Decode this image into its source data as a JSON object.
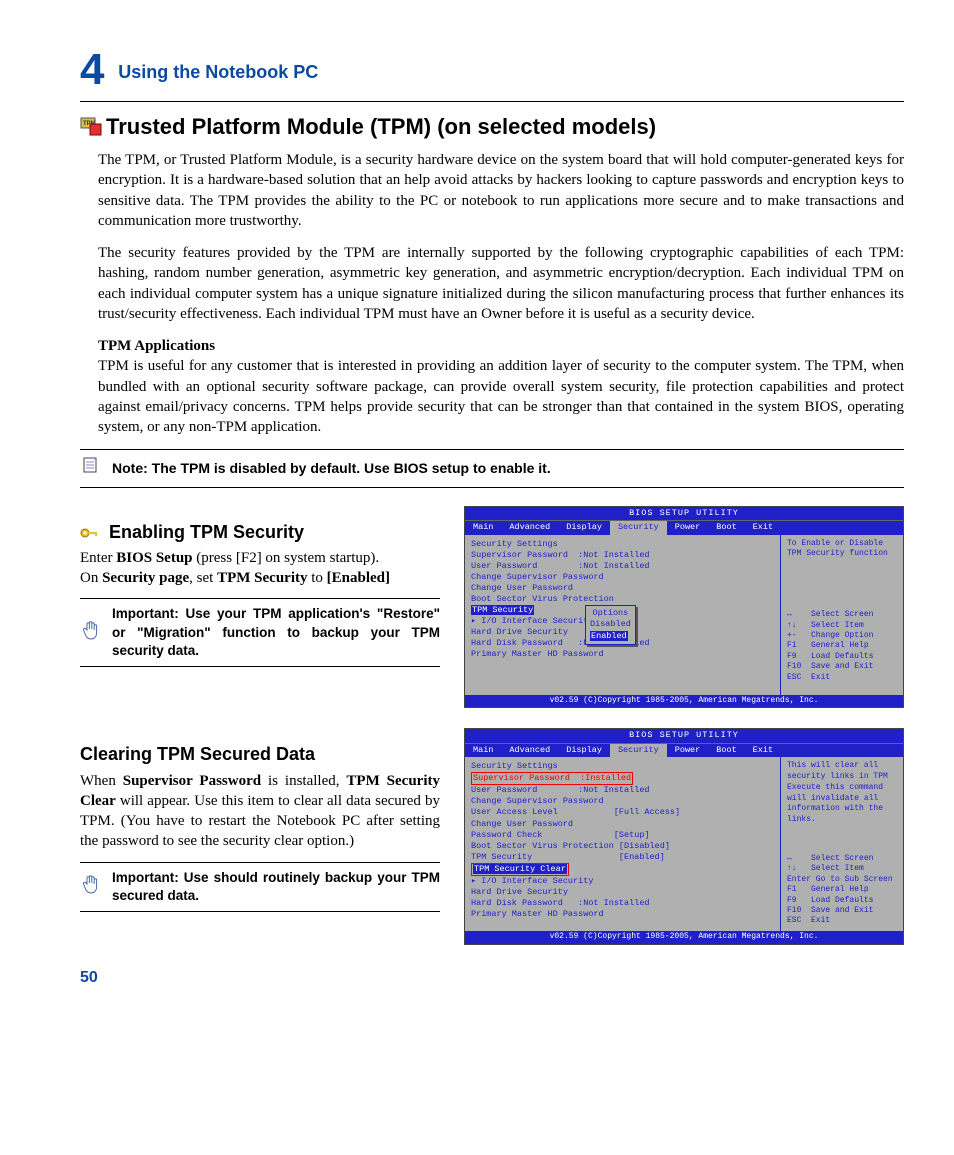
{
  "chapter": {
    "num": "4",
    "title": "Using the Notebook PC"
  },
  "h1": "Trusted Platform Module (TPM) (on selected models)",
  "p1": "The TPM, or Trusted Platform Module, is a security hardware device on the system board that will hold computer-generated keys for encryption. It is a hardware-based solution that an help avoid attacks by hackers looking to capture passwords and encryption keys to sensitive data. The TPM provides the ability to the PC or notebook to run applications more secure and to make transactions and communication more trustworthy.",
  "p2": "The security features provided by the TPM are internally supported by the following cryptographic capabilities of each TPM: hashing, random number generation, asymmetric key generation, and asymmetric encryption/decryption. Each individual TPM on each individual computer system has a unique signature initialized during the silicon manufacturing process that further enhances its trust/security effectiveness. Each individual TPM must have an Owner before it is useful as a security device.",
  "apps_h": "TPM Applications",
  "apps_p": "TPM is useful for any customer that is interested in providing an addition layer of security to the computer system. The TPM, when bundled with an optional security software package, can provide overall system security, file protection capabilities and protect against email/privacy concerns. TPM helps provide security that can be stronger than that contained in the system BIOS, operating system, or any non-TPM application.",
  "note1": "Note: The TPM is disabled by default. Use BIOS setup to enable it.",
  "enable_h": "Enabling TPM Security",
  "enable_p1a": "Enter ",
  "enable_p1b": "BIOS Setup",
  "enable_p1c": " (press [F2] on system startup).",
  "enable_p2a": "On ",
  "enable_p2b": "Security page",
  "enable_p2c": ", set ",
  "enable_p2d": "TPM Security",
  "enable_p2e": " to ",
  "enable_p2f": "[Enabled]",
  "important1": "Important: Use your TPM application's \"Restore\" or \"Migration\" function to backup your TPM security data.",
  "clear_h": "Clearing TPM Secured Data",
  "clear_pa": "When ",
  "clear_pb": "Supervisor Password",
  "clear_pc": " is installed, ",
  "clear_pd": "TPM Security Clear",
  "clear_pe": " will appear. Use this item to clear all data secured by TPM. (You have to restart the Notebook PC after setting the password to see the security clear option.)",
  "important2": "Important: Use should routinely backup your TPM secured data.",
  "page": "50",
  "bios": {
    "title": "BIOS SETUP UTILITY",
    "menu": [
      "Main",
      "Advanced",
      "Display",
      "Security",
      "Power",
      "Boot",
      "Exit"
    ],
    "footer": "v02.59 (C)Copyright 1985-2005, American Megatrends, Inc.",
    "box1": {
      "hint": "To Enable or Disable\nTPM Security function",
      "lines": [
        "Security Settings",
        "",
        "Supervisor Password  :Not Installed",
        "User Password        :Not Installed",
        "",
        "Change Supervisor Password",
        "Change User Password",
        "",
        "Boot Sector Virus Protectio     Options",
        "TPM Security               Disabled",
        "                           Enabled",
        "▸ I/O Interface Security",
        "",
        "Hard Drive Security",
        "",
        "Hard Disk Password   :Not Installed",
        "Primary Master HD Password"
      ],
      "popup": {
        "title": "Options",
        "opts": [
          "Disabled",
          "Enabled"
        ]
      }
    },
    "box2": {
      "hint": "This will clear all\nsecurity links in TPM\nExecute this command\nwill invalidate all\ninformation with the\nlinks.",
      "lines": [
        "Security Settings",
        "",
        "Supervisor Password  :Installed",
        "User Password        :Not Installed",
        "",
        "Change Supervisor Password",
        "User Access Level           [Full Access]",
        "Change User Password",
        "Password Check              [Setup]",
        "",
        "Boot Sector Virus Protection [Disabled]",
        "TPM Security                 [Enabled]",
        "TPM Security Clear",
        "▸ I/O Interface Security",
        "",
        "Hard Drive Security",
        "",
        "Hard Disk Password   :Not Installed",
        "Primary Master HD Password"
      ]
    },
    "help": [
      "↔    Select Screen",
      "↑↓   Select Item",
      "+-   Change Option",
      "F1   General Help",
      "F9   Load Defaults",
      "F10  Save and Exit",
      "ESC  Exit"
    ],
    "help2": [
      "↔    Select Screen",
      "↑↓   Select Item",
      "Enter Go to Sub Screen",
      "F1   General Help",
      "F9   Load Defaults",
      "F10  Save and Exit",
      "ESC  Exit"
    ]
  }
}
